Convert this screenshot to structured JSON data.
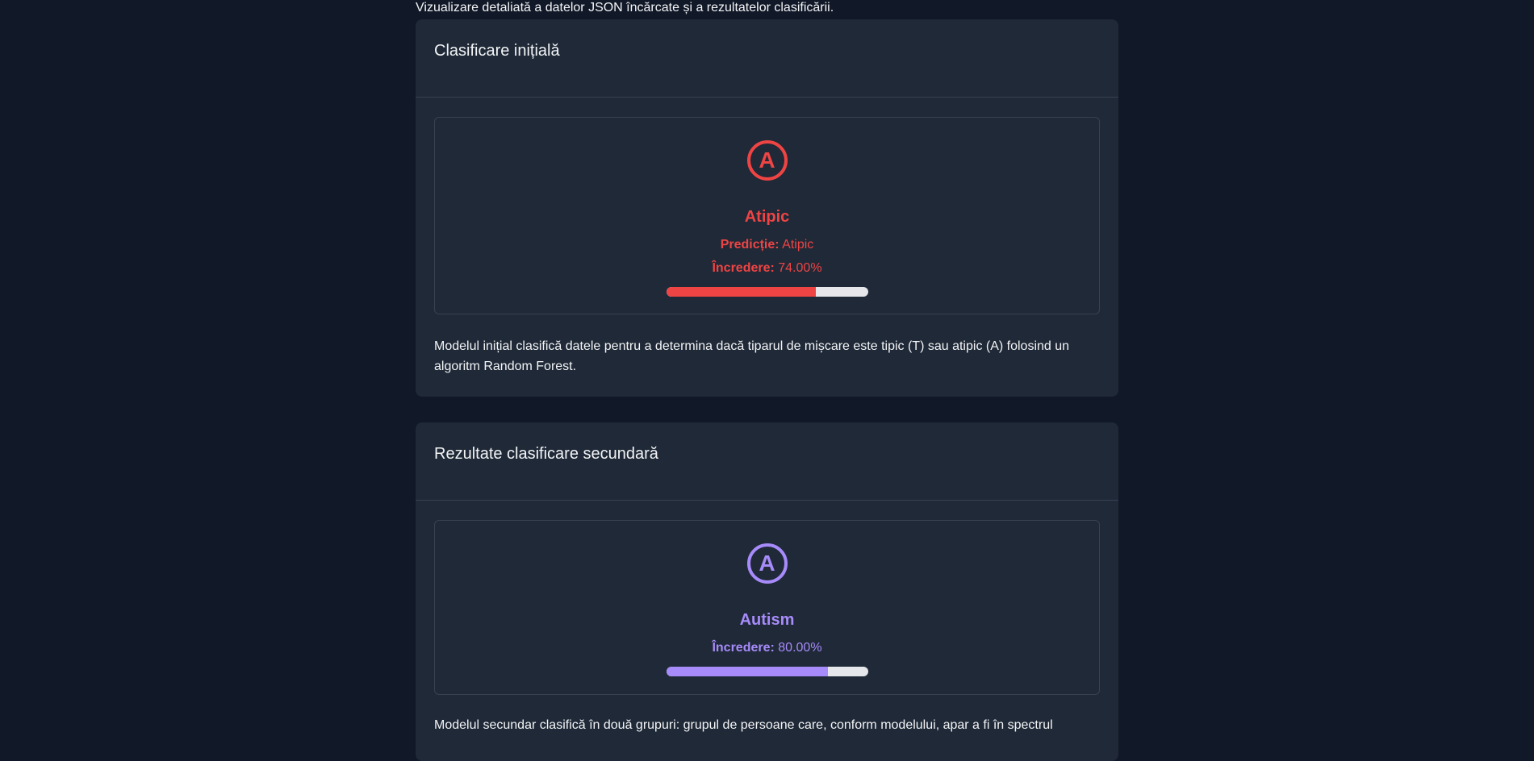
{
  "intro_text": "Vizualizare detaliată a datelor JSON încărcate și a rezultatelor clasificării.",
  "initial": {
    "title": "Clasificare inițială",
    "badge_letter": "A",
    "result_label": "Atipic",
    "prediction_label": "Predicție:",
    "prediction_value": "Atipic",
    "confidence_label": "Încredere:",
    "confidence_value": "74.00%",
    "confidence_fraction": 0.74,
    "color": "#ef4444",
    "description": "Modelul inițial clasifică datele pentru a determina dacă tiparul de mișcare este tipic (T) sau atipic (A) folosind un algoritm Random Forest."
  },
  "secondary": {
    "title": "Rezultate clasificare secundară",
    "badge_letter": "A",
    "result_label": "Autism",
    "confidence_label": "Încredere:",
    "confidence_value": "80.00%",
    "confidence_fraction": 0.8,
    "color": "#a78bfa",
    "description": "Modelul secundar clasifică în două grupuri: grupul de persoane care, conform modelului, apar a fi în spectrul"
  }
}
